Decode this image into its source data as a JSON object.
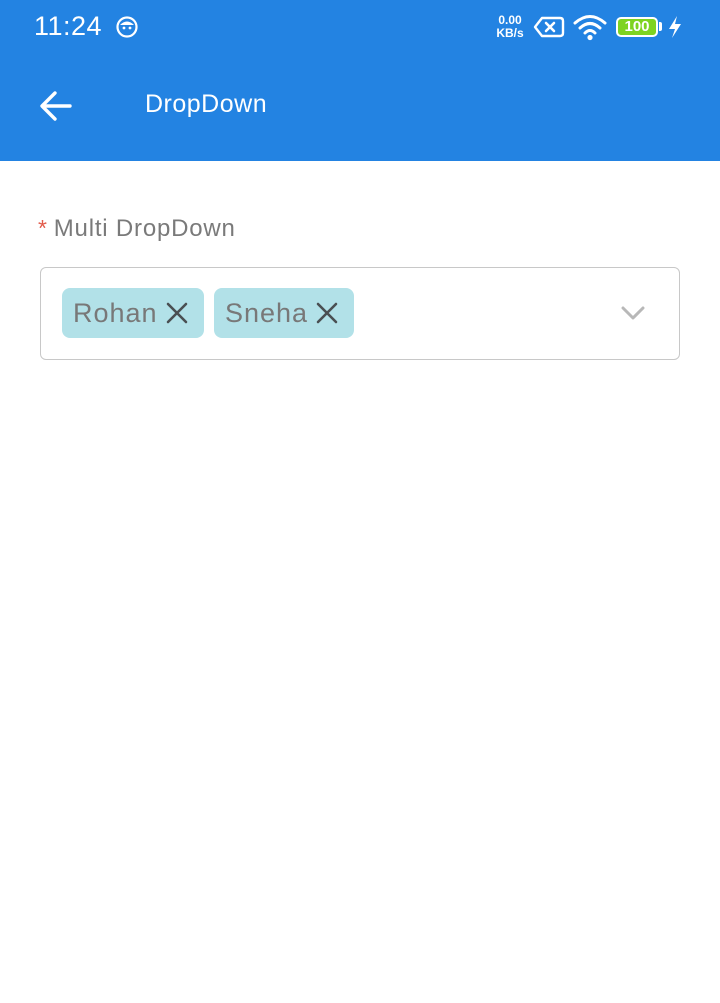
{
  "status_bar": {
    "time": "11:24",
    "net_speed_value": "0.00",
    "net_speed_unit": "KB/s",
    "battery_level": "100",
    "icons": [
      "face-icon",
      "sim-icon",
      "wifi-icon",
      "battery-icon",
      "charging-bolt-icon"
    ]
  },
  "app_bar": {
    "title": "DropDown",
    "back_icon": "arrow-left-icon",
    "background_color": "#2383e2"
  },
  "form": {
    "field_label": "Multi DropDown",
    "required_mark": "*",
    "required_color": "#e25b4b",
    "selected_chips": [
      {
        "label": "Rohan",
        "remove_icon": "close-icon"
      },
      {
        "label": "Sneha",
        "remove_icon": "close-icon"
      }
    ],
    "chip_color": "#b2e1e8",
    "expand_icon": "chevron-down-icon"
  }
}
